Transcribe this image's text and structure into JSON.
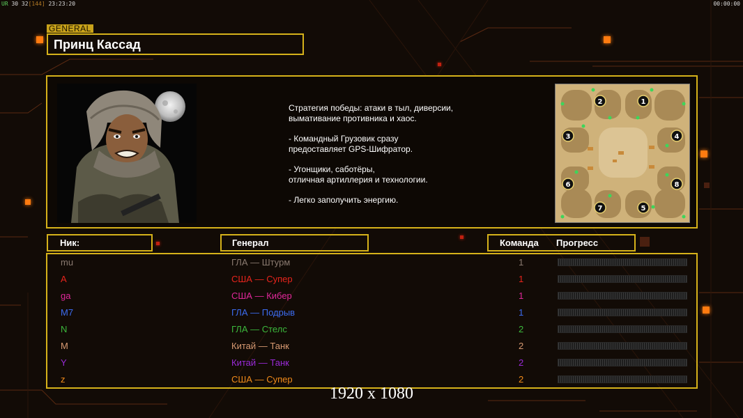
{
  "hud": {
    "fps_label": "UR",
    "fps_values": "30 32",
    "fps_bracket": "[144]",
    "clock": "23:23:20",
    "timer": "00:00:00"
  },
  "general": {
    "tag": "GENERAL",
    "name": "Принц Кассад"
  },
  "strategy_lines": [
    "Стратегия победы: атаки в тыл, диверсии,\n вымативание противника и хаос.",
    "- Командный Грузовик сразу\nпредоставляет GPS-Шифратор.",
    "- Угонщики, саботёры,\nотличная артиллерия и технологии.",
    "- Легко заполучить энергию."
  ],
  "headers": {
    "nick": "Ник:",
    "general": "Генерал",
    "team": "Команда",
    "progress": "Прогресс"
  },
  "map_spawns": [
    "1",
    "2",
    "3",
    "4",
    "5",
    "6",
    "7",
    "8"
  ],
  "players": [
    {
      "nick": "mu",
      "general": "ГЛА — Штурм",
      "team": "1",
      "progress": 0,
      "color": "#8a7a70"
    },
    {
      "nick": "A",
      "general": "США — Супер",
      "team": "1",
      "progress": 0,
      "color": "#e8241c"
    },
    {
      "nick": "ga",
      "general": "США — Кибер",
      "team": "1",
      "progress": 0,
      "color": "#e0289a"
    },
    {
      "nick": "M7",
      "general": "ГЛА — Подрыв",
      "team": "1",
      "progress": 0,
      "color": "#3c6cf0"
    },
    {
      "nick": "N",
      "general": "ГЛА — Стелс",
      "team": "2",
      "progress": 0,
      "color": "#3cb83c"
    },
    {
      "nick": "M",
      "general": "Китай — Танк",
      "team": "2",
      "progress": 0,
      "color": "#d89a72"
    },
    {
      "nick": "Y",
      "general": "Китай — Танк",
      "team": "2",
      "progress": 0,
      "color": "#9a2ad8"
    },
    {
      "nick": "z",
      "general": "США — Супер",
      "team": "2",
      "progress": 0,
      "color": "#f08a1a"
    }
  ],
  "resolution": "1920 x 1080",
  "colors": {
    "frame": "#d6b21a",
    "accent": "#ff7b10"
  }
}
